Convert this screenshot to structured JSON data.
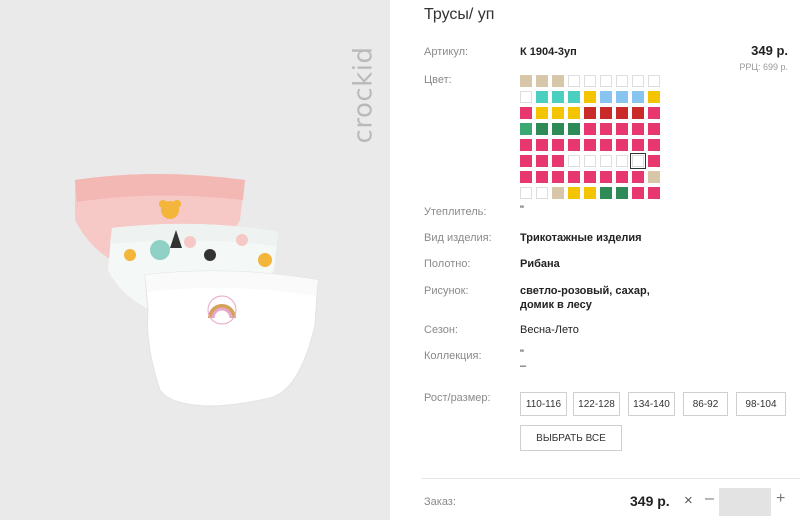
{
  "product": {
    "title": "Трусы/ уп",
    "article_label": "Артикул:",
    "article": "К 1904-3уп",
    "price": "349 р.",
    "rrp": "РРЦ: 699 р.",
    "color_label": "Цвет:",
    "insulation_label": "Утеплитель:",
    "insulation": "\"",
    "kind_label": "Вид изделия:",
    "kind": "Трикотажные изделия",
    "fabric_label": "Полотно:",
    "fabric": "Рибана",
    "pattern_label": "Рисунок:",
    "pattern_line1": "светло-розовый, сахар,",
    "pattern_line2": "домик в лесу",
    "season_label": "Сезон:",
    "season": "Весна-Лето",
    "collection_label": "Коллекция:",
    "collection_line1": "\"",
    "collection_line2": "–",
    "size_label": "Рост/размер:",
    "sizes": [
      "110-116",
      "122-128",
      "134-140",
      "86-92",
      "98-104"
    ],
    "select_all": "ВЫБРАТЬ ВСЕ"
  },
  "order": {
    "label": "Заказ:",
    "price": "349 р.",
    "remove_symbol": "×",
    "minus": "–",
    "plus": "+"
  },
  "brand": {
    "logo_text": "crockid"
  },
  "swatches": {
    "selected_index": 52,
    "colors": [
      "#d8c6a8",
      "#d8c6a8",
      "#d8c6a8",
      "#ffffff",
      "#ffffff",
      "#ffffff",
      "#ffffff",
      "#ffffff",
      "#ffffff",
      "#ffffff",
      "#4bcfc0",
      "#4bcfc0",
      "#4bcfc0",
      "#f5c400",
      "#88c4f0",
      "#88c4f0",
      "#88c4f0",
      "#f5c400",
      "#e8366f",
      "#f5c400",
      "#f5c400",
      "#f5c400",
      "#c92a2a",
      "#c92a2a",
      "#c92a2a",
      "#c92a2a",
      "#e8366f",
      "#3aa870",
      "#2e8b57",
      "#2e8b57",
      "#2e8b57",
      "#e8366f",
      "#e8366f",
      "#e8366f",
      "#e8366f",
      "#e8366f",
      "#e8366f",
      "#e8366f",
      "#e8366f",
      "#e8366f",
      "#e8366f",
      "#e8366f",
      "#e8366f",
      "#e8366f",
      "#e8366f",
      "#e8366f",
      "#e8366f",
      "#e8366f",
      "#ffffff",
      "#ffffff",
      "#ffffff",
      "#ffffff",
      "#ffffff",
      "#e8366f",
      "#e8366f",
      "#e8366f",
      "#e8366f",
      "#e8366f",
      "#e8366f",
      "#e8366f",
      "#e8366f",
      "#e8366f",
      "#d8c6a8",
      "#ffffff",
      "#ffffff",
      "#d8c6a8",
      "#f5c400",
      "#f5c400",
      "#2e8b57",
      "#2e8b57",
      "#e8366f",
      "#e8366f"
    ]
  }
}
